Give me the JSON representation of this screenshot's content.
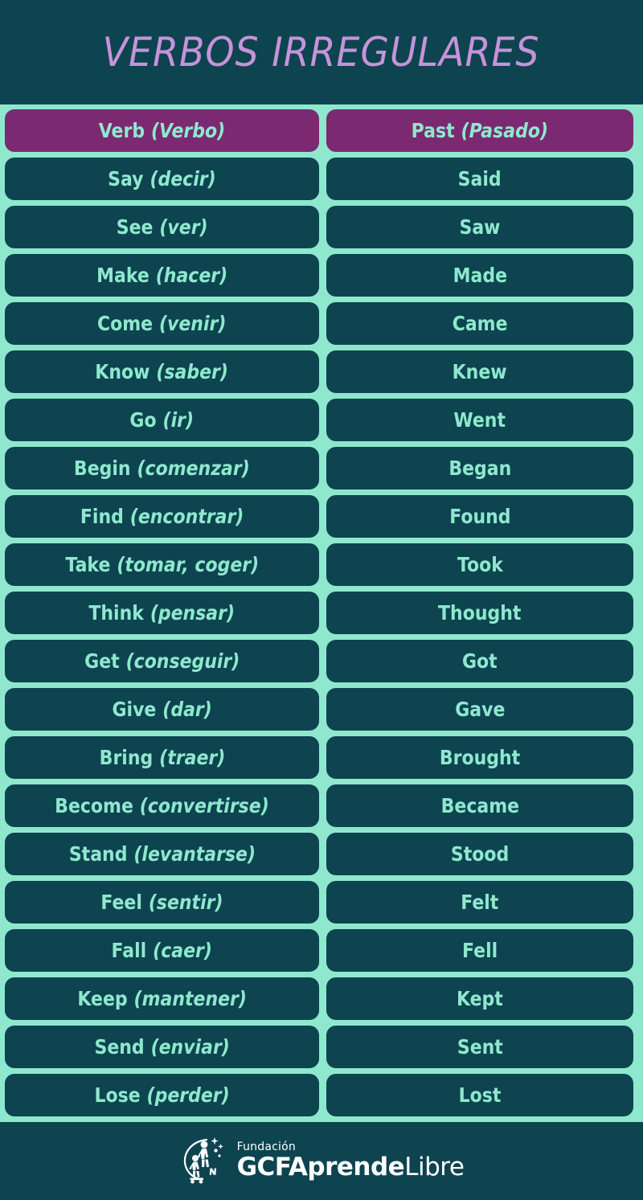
{
  "title": "VERBOS IRREGULARES",
  "colors": {
    "background": "#0D4450",
    "band": "#8FE8CE",
    "header_cell": "#7B2A72",
    "body_cell": "#0D4450",
    "cell_text": "#8FE8CE",
    "title_text": "#C793D8",
    "logo_text": "#FFFFFF"
  },
  "table": {
    "header": {
      "verb_en": "Verb",
      "verb_es": "(Verbo)",
      "past_en": "Past",
      "past_es": "(Pasado)"
    },
    "rows": [
      {
        "verb_en": "Say",
        "verb_es": "(decir)",
        "past": "Said"
      },
      {
        "verb_en": "See",
        "verb_es": "(ver)",
        "past": "Saw"
      },
      {
        "verb_en": "Make",
        "verb_es": "(hacer)",
        "past": "Made"
      },
      {
        "verb_en": "Come",
        "verb_es": "(venir)",
        "past": "Came"
      },
      {
        "verb_en": "Know",
        "verb_es": "(saber)",
        "past": "Knew"
      },
      {
        "verb_en": "Go",
        "verb_es": "(ir)",
        "past": "Went"
      },
      {
        "verb_en": "Begin",
        "verb_es": "(comenzar)",
        "past": "Began"
      },
      {
        "verb_en": "Find",
        "verb_es": "(encontrar)",
        "past": "Found"
      },
      {
        "verb_en": "Take",
        "verb_es": "(tomar, coger)",
        "past": "Took"
      },
      {
        "verb_en": "Think",
        "verb_es": "(pensar)",
        "past": "Thought"
      },
      {
        "verb_en": "Get",
        "verb_es": "(conseguir)",
        "past": "Got"
      },
      {
        "verb_en": "Give",
        "verb_es": "(dar)",
        "past": "Gave"
      },
      {
        "verb_en": "Bring",
        "verb_es": "(traer)",
        "past": "Brought"
      },
      {
        "verb_en": "Become",
        "verb_es": "(convertirse)",
        "past": "Became"
      },
      {
        "verb_en": "Stand",
        "verb_es": "(levantarse)",
        "past": "Stood"
      },
      {
        "verb_en": "Feel",
        "verb_es": "(sentir)",
        "past": "Felt"
      },
      {
        "verb_en": "Fall",
        "verb_es": "(caer)",
        "past": "Fell"
      },
      {
        "verb_en": "Keep",
        "verb_es": "(mantener)",
        "past": "Kept"
      },
      {
        "verb_en": "Send",
        "verb_es": "(enviar)",
        "past": "Sent"
      },
      {
        "verb_en": "Lose",
        "verb_es": "(perder)",
        "past": "Lost"
      }
    ]
  },
  "footer": {
    "fundacion": "Fundación",
    "brand_bold_1": "GCF",
    "brand_bold_2": "Aprende",
    "brand_light": "Libre"
  }
}
